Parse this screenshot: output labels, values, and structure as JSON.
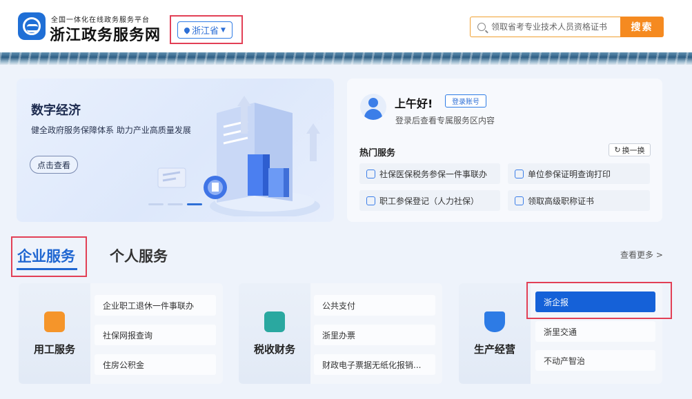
{
  "header": {
    "brand_sub": "全国一体化在线政务服务平台",
    "brand_title": "浙江政务服务网",
    "region": "浙江省",
    "search_placeholder": "领取省考专业技术人员资格证书",
    "search_button": "搜索"
  },
  "banner": {
    "title": "数字经济",
    "subtitle": "健全政府服务保障体系 助力产业高质量发展",
    "button": "点击查看",
    "active_slide": 3,
    "slide_count": 3
  },
  "login": {
    "greeting": "上午好!",
    "login_button": "登录账号",
    "tip": "登录后查看专属服务区内容",
    "hot_title": "热门服务",
    "refresh": "换一换",
    "hot_items": [
      {
        "label": "社保医保税务参保一件事联办",
        "icon": "shield-icon"
      },
      {
        "label": "单位参保证明查询打印",
        "icon": "print-icon"
      },
      {
        "label": "职工参保登记（人力社保）",
        "icon": "user-icon"
      },
      {
        "label": "领取高级职称证书",
        "icon": "certificate-icon"
      }
    ]
  },
  "tabs": {
    "enterprise": "企业服务",
    "personal": "个人服务",
    "more": "查看更多 >"
  },
  "cards": [
    {
      "label": "用工服务",
      "icon": "briefcase-icon",
      "color": "#f5952a",
      "items": [
        "企业职工退休一件事联办",
        "社保网报查询",
        "住房公积金"
      ]
    },
    {
      "label": "税收财务",
      "icon": "tax-icon",
      "color": "#2aa8a0",
      "items": [
        "公共支付",
        "浙里办票",
        "财政电子票据无纸化报销..."
      ]
    },
    {
      "label": "生产经营",
      "icon": "shield-icon",
      "color": "#2d7be5",
      "items": [
        "浙企报",
        "浙里交通",
        "不动产智治"
      ]
    }
  ],
  "colors": {
    "accent": "#1f66d1",
    "search_button": "#f58a20",
    "highlight_border": "#e23f55",
    "active_item": "#1561d8"
  }
}
